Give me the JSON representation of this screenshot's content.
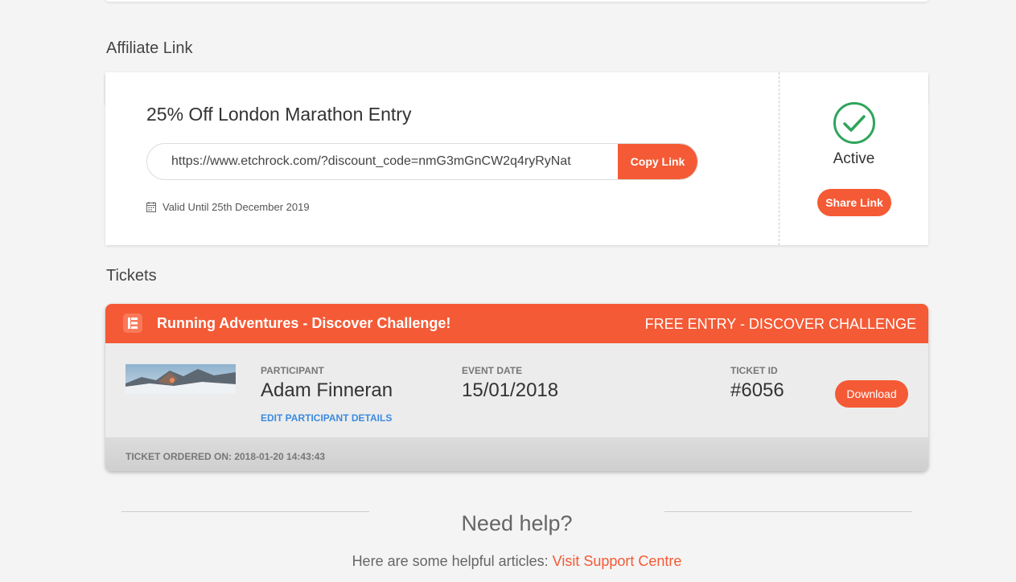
{
  "affiliate": {
    "section_title": "Affiliate Link",
    "offer_title": "25% Off London Marathon Entry",
    "link_value": "https://www.etchrock.com/?discount_code=nmG3mGnCW2q4ryRyNat",
    "copy_label": "Copy Link",
    "valid_until": "Valid Until 25th December 2019",
    "status": "Active",
    "share_label": "Share Link",
    "status_color": "#2ea55c"
  },
  "tickets": {
    "section_title": "Tickets",
    "event_name": "Running Adventures - Discover Challenge!",
    "entry_type": "FREE ENTRY - DISCOVER CHALLENGE",
    "participant_label": "PARTICIPANT",
    "participant_name": "Adam Finneran",
    "edit_label": "EDIT PARTICIPANT DETAILS",
    "event_date_label": "EVENT DATE",
    "event_date": "15/01/2018",
    "ticket_id_label": "TICKET ID",
    "ticket_id": "#6056",
    "download_label": "Download",
    "ordered_on": "TICKET ORDERED ON: 2018-01-20 14:43:43"
  },
  "help": {
    "title": "Need help?",
    "text": "Here are some helpful articles: ",
    "link_label": "Visit Support Centre"
  },
  "colors": {
    "accent": "#f45a35",
    "link_blue": "#3b8ae0"
  }
}
